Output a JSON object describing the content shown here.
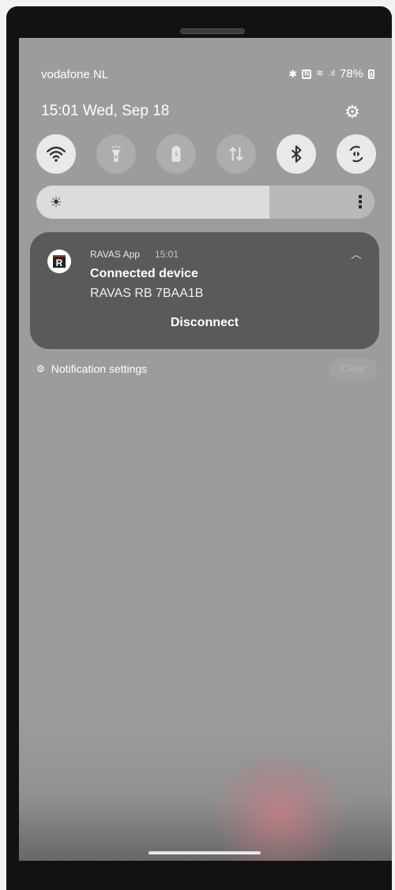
{
  "status_bar": {
    "carrier": "vodafone NL",
    "battery": "78%",
    "icons": [
      "bluetooth-icon",
      "nfc-icon",
      "wifi-calling-icon",
      "signal-icon",
      "battery-icon"
    ]
  },
  "header": {
    "datetime": "15:01  Wed, Sep 18",
    "settings_icon": "gear-icon"
  },
  "quick_settings": [
    {
      "name": "wifi",
      "icon": "wifi-icon",
      "state": "on"
    },
    {
      "name": "flashlight",
      "icon": "flashlight-icon",
      "state": "off"
    },
    {
      "name": "power-saving",
      "icon": "battery-saver-icon",
      "state": "off"
    },
    {
      "name": "mobile-data",
      "icon": "mobile-data-icon",
      "state": "off"
    },
    {
      "name": "bluetooth",
      "icon": "bluetooth-icon",
      "state": "on"
    },
    {
      "name": "auto-rotate",
      "icon": "rotate-icon",
      "state": "on"
    }
  ],
  "brightness": {
    "level": 0.69
  },
  "notification": {
    "app_name": "RAVAS App",
    "time": "15:01",
    "title": "Connected device",
    "body": "RAVAS RB 7BAA1B",
    "action": "Disconnect"
  },
  "footer": {
    "settings_label": "Notification settings",
    "clear_label": "Clear"
  },
  "colors": {
    "screen_bg": "#9c9c9c",
    "notification_bg": "#5a5a5a",
    "tile_on": "#e9e9e9",
    "tile_off": "#adadad"
  }
}
